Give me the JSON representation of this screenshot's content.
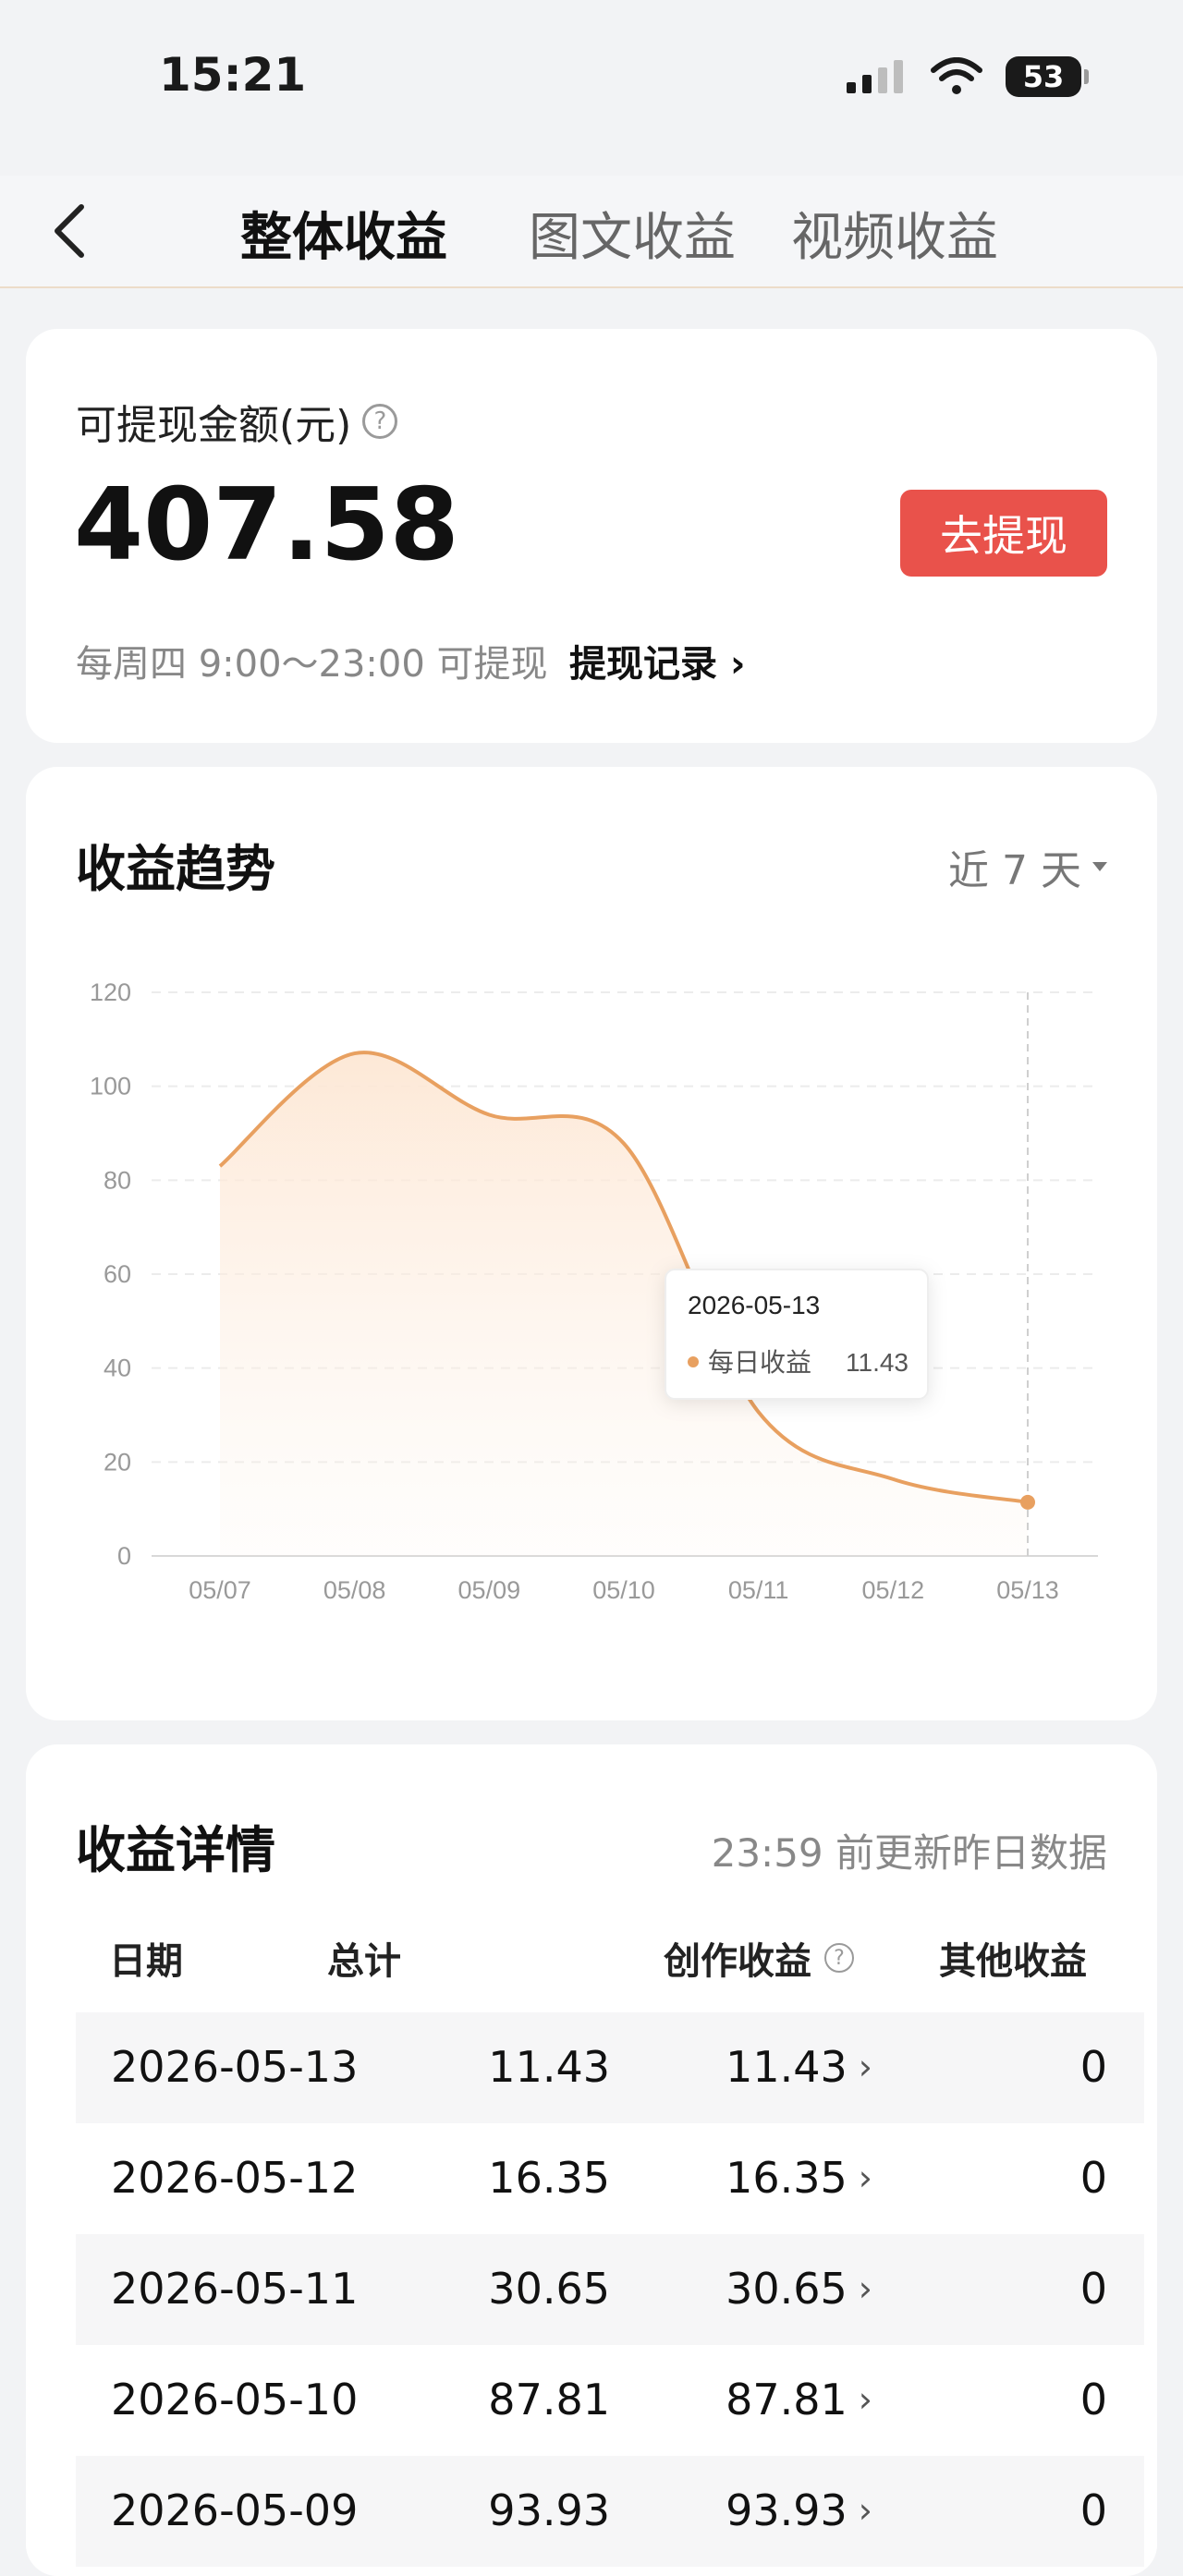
{
  "status_bar": {
    "time": "15:21",
    "battery": "53"
  },
  "nav": {
    "tabs": [
      {
        "label": "整体收益",
        "active": true
      },
      {
        "label": "图文收益",
        "active": false
      },
      {
        "label": "视频收益",
        "active": false
      }
    ]
  },
  "balance": {
    "label": "可提现金额(元)",
    "amount": "407.58",
    "withdraw_button": "去提现",
    "hint": "每周四 9:00～23:00 可提现",
    "record_link": "提现记录"
  },
  "trend": {
    "title": "收益趋势",
    "range": "近 7 天",
    "tooltip": {
      "date": "2026-05-13",
      "series": "每日收益",
      "value": "11.43"
    }
  },
  "chart_data": {
    "type": "area",
    "x": [
      "05/07",
      "05/08",
      "05/09",
      "05/10",
      "05/11",
      "05/12",
      "05/13"
    ],
    "series": [
      {
        "name": "每日收益",
        "values": [
          83,
          107,
          93.93,
          87.81,
          30.65,
          16.35,
          11.43
        ]
      }
    ],
    "ylim": [
      0,
      120
    ],
    "yticks": [
      0,
      20,
      40,
      60,
      80,
      100,
      120
    ],
    "grid": true,
    "colors": {
      "line": "#e8a060",
      "fill_top": "#fde9d9"
    }
  },
  "detail": {
    "title": "收益详情",
    "note": "23:59 前更新昨日数据",
    "headers": {
      "date": "日期",
      "total": "总计",
      "creation": "创作收益",
      "other": "其他收益"
    },
    "rows": [
      {
        "date": "2026-05-13",
        "total": "11.43",
        "creation": "11.43",
        "other": "0"
      },
      {
        "date": "2026-05-12",
        "total": "16.35",
        "creation": "16.35",
        "other": "0"
      },
      {
        "date": "2026-05-11",
        "total": "30.65",
        "creation": "30.65",
        "other": "0"
      },
      {
        "date": "2026-05-10",
        "total": "87.81",
        "creation": "87.81",
        "other": "0"
      },
      {
        "date": "2026-05-09",
        "total": "93.93",
        "creation": "93.93",
        "other": "0"
      }
    ]
  }
}
